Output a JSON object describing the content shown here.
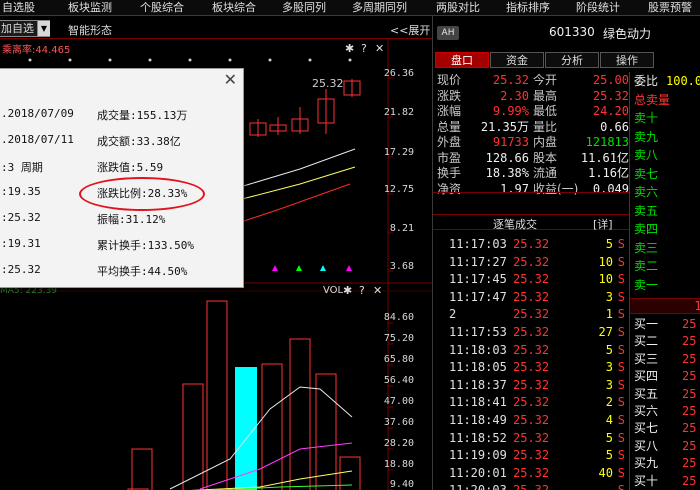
{
  "menu": [
    "自选股",
    "板块监测",
    "个股综合",
    "板块综合",
    "多股同列",
    "多周期同列",
    "两股对比",
    "指标排序",
    "阶段统计",
    "股票预警"
  ],
  "toolbar": {
    "add_fav": "加自选",
    "smart": "智能形态",
    "expand": "<<展开"
  },
  "chart": {
    "indicator_text": "乘离率:44.465",
    "price_tag": "25.32",
    "upper_axis": [
      "26.36",
      "21.82",
      "17.29",
      "12.75",
      "8.21",
      "3.68"
    ],
    "lower_axis": [
      "84.60",
      "75.20",
      "65.80",
      "56.40",
      "47.00",
      "37.60",
      "28.20",
      "18.80",
      "9.40"
    ],
    "vol_label": "VOL",
    "ma_text": "MA5: 223.39",
    "colors": {
      "bar_up": "#ff3232",
      "bar_highlight": "#00ffff",
      "ma_white": "#e8e8e8",
      "ma_yellow": "#ffff64",
      "ma_magenta": "#ff3cff",
      "ma_green": "#32ff32",
      "ma_red": "#ff2a2a"
    }
  },
  "popup": {
    "close": "✕",
    "left": [
      ".2018/07/09",
      ".2018/07/11",
      ":3 周期",
      ":19.35",
      ":25.32",
      ":19.31",
      ":25.32"
    ],
    "right": [
      "成交量:155.13万",
      "成交额:33.38亿",
      "涨跌值:5.59",
      "涨跌比例:28.33%",
      "振幅:31.12%",
      "累计换手:133.50%",
      "平均换手:44.50%"
    ]
  },
  "stock": {
    "badge": "AH",
    "code": "601330",
    "name": "绿色动力"
  },
  "tabs": [
    "盘口",
    "资金",
    "分析",
    "操作"
  ],
  "quote_rows": [
    {
      "l1": "现价",
      "v1": "25.32",
      "c1": "red",
      "l2": "今开",
      "v2": "25.00",
      "c2": "red"
    },
    {
      "l1": "涨跌",
      "v1": "2.30",
      "c1": "red",
      "l2": "最高",
      "v2": "25.32",
      "c2": "red"
    },
    {
      "l1": "涨幅",
      "v1": "9.99%",
      "c1": "red",
      "l2": "最低",
      "v2": "24.20",
      "c2": "red"
    },
    {
      "l1": "总量",
      "v1": "21.35万",
      "c1": "white",
      "l2": "量比",
      "v2": "0.66",
      "c2": "white"
    },
    {
      "l1": "外盘",
      "v1": "91733",
      "c1": "red",
      "l2": "内盘",
      "v2": "121813",
      "c2": "green"
    },
    {
      "l1": "市盈",
      "v1": "128.66",
      "c1": "white",
      "l2": "股本",
      "v2": "11.61亿",
      "c2": "white"
    },
    {
      "l1": "换手",
      "v1": "18.38%",
      "c1": "white",
      "l2": "流通",
      "v2": "1.16亿",
      "c2": "white"
    },
    {
      "l1": "净资",
      "v1": "1.97",
      "c1": "white",
      "l2": "收益(一)",
      "v2": "0.049",
      "c2": "white"
    }
  ],
  "trades_header": {
    "title": "逐笔成交",
    "detail": "[详]"
  },
  "trades": [
    {
      "time": "11:17:03",
      "price": "25.32",
      "vol": "5",
      "side": "S"
    },
    {
      "time": "11:17:27",
      "price": "25.32",
      "vol": "10",
      "side": "S"
    },
    {
      "time": "11:17:45",
      "price": "25.32",
      "vol": "10",
      "side": "S"
    },
    {
      "time": "11:17:47",
      "price": "25.32",
      "vol": "3",
      "side": "S"
    },
    {
      "time": "2",
      "price": "25.32",
      "vol": "1",
      "side": "S"
    },
    {
      "time": "11:17:53",
      "price": "25.32",
      "vol": "27",
      "side": "S"
    },
    {
      "time": "11:18:03",
      "price": "25.32",
      "vol": "5",
      "side": "S"
    },
    {
      "time": "11:18:05",
      "price": "25.32",
      "vol": "3",
      "side": "S"
    },
    {
      "time": "11:18:37",
      "price": "25.32",
      "vol": "3",
      "side": "S"
    },
    {
      "time": "11:18:41",
      "price": "25.32",
      "vol": "2",
      "side": "S"
    },
    {
      "time": "11:18:49",
      "price": "25.32",
      "vol": "4",
      "side": "S"
    },
    {
      "time": "11:18:52",
      "price": "25.32",
      "vol": "5",
      "side": "S"
    },
    {
      "time": "11:19:09",
      "price": "25.32",
      "vol": "5",
      "side": "S"
    },
    {
      "time": "11:20:01",
      "price": "25.32",
      "vol": "40",
      "side": "S"
    },
    {
      "time": "11:20:03",
      "price": "25.32",
      "vol": "",
      "side": "S"
    }
  ],
  "order_book": {
    "top": [
      {
        "label": "委比",
        "value": "100.0",
        "c": "yellow"
      },
      {
        "label": "总卖量",
        "value": "",
        "c": "green"
      },
      {
        "label": "卖十",
        "value": "",
        "c": "white"
      },
      {
        "label": "卖九",
        "value": "",
        "c": "white"
      },
      {
        "label": "卖八",
        "value": "",
        "c": "white"
      },
      {
        "label": "卖七",
        "value": "",
        "c": "white"
      },
      {
        "label": "卖六",
        "value": "",
        "c": "white"
      },
      {
        "label": "卖五",
        "value": "",
        "c": "white"
      },
      {
        "label": "卖四",
        "value": "",
        "c": "white"
      },
      {
        "label": "卖三",
        "value": "",
        "c": "white"
      },
      {
        "label": "卖二",
        "value": "",
        "c": "white"
      },
      {
        "label": "卖一",
        "value": "",
        "c": "white"
      }
    ],
    "divider_value": "1",
    "bottom": [
      {
        "label": "买一",
        "value": "25",
        "c": "red"
      },
      {
        "label": "买二",
        "value": "25",
        "c": "red"
      },
      {
        "label": "买三",
        "value": "25",
        "c": "red"
      },
      {
        "label": "买四",
        "value": "25",
        "c": "red"
      },
      {
        "label": "买五",
        "value": "25",
        "c": "red"
      },
      {
        "label": "买六",
        "value": "25",
        "c": "red"
      },
      {
        "label": "买七",
        "value": "25",
        "c": "red"
      },
      {
        "label": "买八",
        "value": "25",
        "c": "red"
      },
      {
        "label": "买九",
        "value": "25",
        "c": "red"
      },
      {
        "label": "买十",
        "value": "25",
        "c": "red"
      }
    ]
  }
}
